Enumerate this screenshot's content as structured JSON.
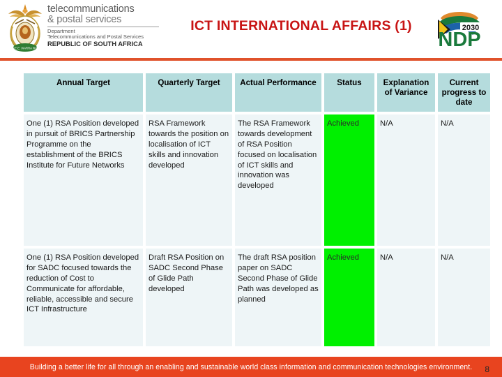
{
  "header": {
    "title": "ICT INTERNATIONAL AFFAIRS (1)",
    "title_color": "#c81414",
    "coat_of_arms_alt": "south-african-coat-of-arms",
    "department": {
      "line1": "telecommunications",
      "line2": "& postal services",
      "line3": "Department",
      "line4": "Telecommunications and Postal Services",
      "line5": "REPUBLIC OF SOUTH AFRICA"
    },
    "ndp_logo": {
      "year": "2030",
      "acronym": "NDP"
    },
    "rule_color": "#e0522b"
  },
  "table": {
    "columns": [
      "Annual Target",
      "Quarterly Target",
      "Actual Performance",
      "Status",
      "Explanation of Variance",
      "Current progress to date"
    ],
    "header_bg": "#b5dcdd",
    "cell_bg": "#eef5f7",
    "status_achieved_bg": "#00f000",
    "rows": [
      {
        "annual_target": "One (1) RSA Position developed in pursuit of BRICS Partnership Programme on the establishment of the BRICS Institute for Future Networks",
        "quarterly_target": "RSA Framework towards the position on localisation of ICT skills and innovation developed",
        "actual_performance": "The RSA Framework towards development of RSA Position focused on localisation of ICT skills and innovation was developed",
        "status": "Achieved",
        "explanation_of_variance": "N/A",
        "current_progress": "N/A"
      },
      {
        "annual_target": "One (1) RSA Position developed for SADC focused towards the reduction of Cost to Communicate for affordable, reliable, accessible and secure ICT Infrastructure",
        "quarterly_target": "Draft RSA Position on SADC Second Phase of Glide Path developed",
        "actual_performance": "The draft RSA position paper on SADC Second Phase of Glide Path was developed as planned",
        "status": "Achieved",
        "explanation_of_variance": "N/A",
        "current_progress": "N/A"
      }
    ]
  },
  "footer": {
    "tagline": "Building a better life for all through an enabling and sustainable world class information and communication technologies environment.",
    "band_color": "#e8441f",
    "page_number": "8"
  }
}
